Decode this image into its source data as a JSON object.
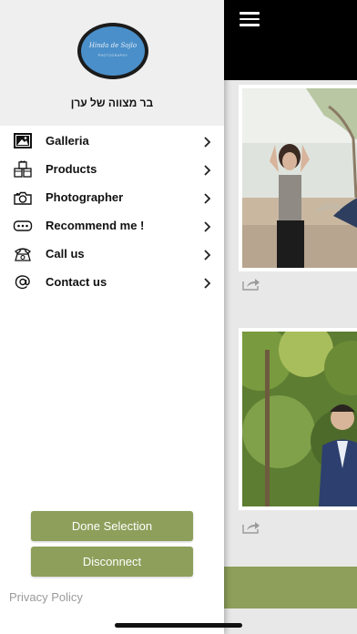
{
  "drawer": {
    "logo": {
      "script_text": "Hinda de Sojlo",
      "sub_text": "PHOTOGRAPHY"
    },
    "title": "בר מצווה של ערן",
    "menu": [
      {
        "label": "Galleria",
        "icon": "gallery-icon"
      },
      {
        "label": "Products",
        "icon": "products-icon"
      },
      {
        "label": "Photographer",
        "icon": "camera-icon"
      },
      {
        "label": "Recommend me !",
        "icon": "chat-bubble-icon"
      },
      {
        "label": "Call us",
        "icon": "phone-icon"
      },
      {
        "label": "Contact us",
        "icon": "at-sign-icon"
      }
    ],
    "buttons": {
      "done_selection": "Done Selection",
      "disconnect": "Disconnect"
    },
    "privacy_policy": "Privacy Policy"
  },
  "colors": {
    "accent": "#8d9f5a",
    "header_bg": "#000000",
    "drawer_head_bg": "#efefef",
    "logo_blue": "#4a8fc9"
  }
}
